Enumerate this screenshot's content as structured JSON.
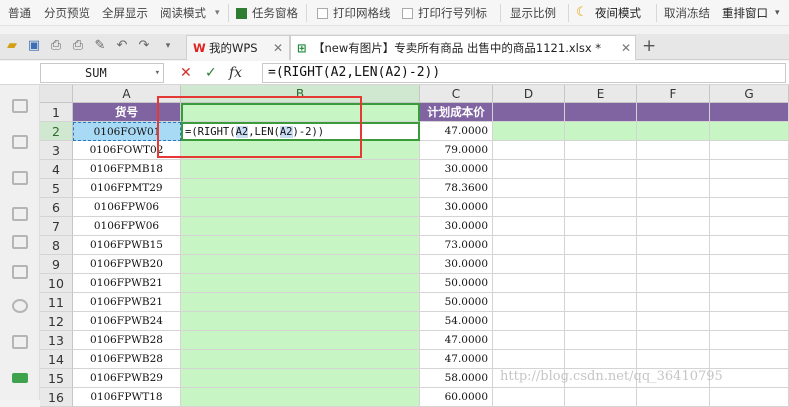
{
  "viewbar": {
    "items": [
      "普通",
      "分页预览",
      "全屏显示",
      "阅读模式"
    ],
    "task_pane": "任务窗格",
    "print_gridlines": "打印网格线",
    "print_row_col": "打印行号列标",
    "display_ratio": "显示比例",
    "night_mode": "夜间模式",
    "unfreeze": "取消冻结",
    "rearrange": "重排窗口"
  },
  "tabs": {
    "home": "我的WPS",
    "file": "【new有图片】专卖所有商品 出售中的商品1121.xlsx *"
  },
  "formula_bar": {
    "name_box": "SUM",
    "cancel": "✕",
    "confirm": "✓",
    "fx": "fx",
    "formula": "=(RIGHT(A2,LEN(A2)-2))"
  },
  "columns": [
    "A",
    "B",
    "C",
    "D",
    "E",
    "F",
    "G"
  ],
  "header_row": {
    "a": "货号",
    "b": "",
    "c": "计划成本价"
  },
  "editing": {
    "prefix": "=(RIGHT(",
    "ref1": "A2",
    "mid": ",LEN(",
    "ref2": "A2",
    "suffix": ")-2))"
  },
  "rows": [
    {
      "n": "1"
    },
    {
      "n": "2",
      "a": "0106FOW01",
      "c": "47.0000"
    },
    {
      "n": "3",
      "a": "0106FOWT02",
      "c": "79.0000"
    },
    {
      "n": "4",
      "a": "0106FPMB18",
      "c": "30.0000"
    },
    {
      "n": "5",
      "a": "0106FPMT29",
      "c": "78.3600"
    },
    {
      "n": "6",
      "a": "0106FPW06",
      "c": "30.0000"
    },
    {
      "n": "7",
      "a": "0106FPW06",
      "c": "30.0000"
    },
    {
      "n": "8",
      "a": "0106FPWB15",
      "c": "73.0000"
    },
    {
      "n": "9",
      "a": "0106FPWB20",
      "c": "30.0000"
    },
    {
      "n": "10",
      "a": "0106FPWB21",
      "c": "50.0000"
    },
    {
      "n": "11",
      "a": "0106FPWB21",
      "c": "50.0000"
    },
    {
      "n": "12",
      "a": "0106FPWB24",
      "c": "54.0000"
    },
    {
      "n": "13",
      "a": "0106FPWB28",
      "c": "47.0000"
    },
    {
      "n": "14",
      "a": "0106FPWB28",
      "c": "47.0000"
    },
    {
      "n": "15",
      "a": "0106FPWB29",
      "c": "58.0000"
    },
    {
      "n": "16",
      "a": "0106FPWT18",
      "c": "60.0000"
    }
  ],
  "watermark": "http://blog.csdn.net/qq_36410795"
}
